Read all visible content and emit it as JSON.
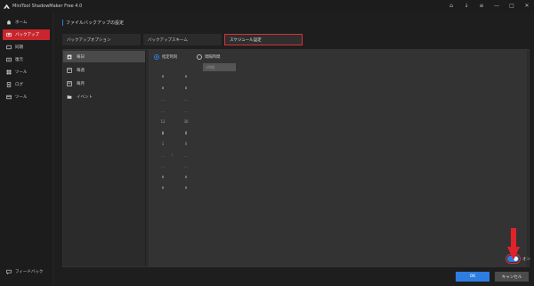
{
  "app": {
    "title": "MiniTool ShadowMaker Free 4.0",
    "window_controls": [
      "⌂",
      "↓",
      "≡",
      "—",
      "□",
      "✕"
    ]
  },
  "sidebar": {
    "items": [
      {
        "label": "ホーム",
        "icon": "home-icon",
        "active": false
      },
      {
        "label": "バックアップ",
        "icon": "backup-icon",
        "active": true
      },
      {
        "label": "同期",
        "icon": "sync-icon",
        "active": false
      },
      {
        "label": "復元",
        "icon": "restore-icon",
        "active": false
      },
      {
        "label": "ツール",
        "icon": "tools-icon",
        "active": false
      },
      {
        "label": "ログ",
        "icon": "log-icon",
        "active": false
      },
      {
        "label": "ツール",
        "icon": "tool2-icon",
        "active": false
      }
    ],
    "feedback_label": "フィードバック"
  },
  "page": {
    "title": "ファイルバックアップの設定",
    "tabs": [
      {
        "label": "バックアップオプション",
        "active": false
      },
      {
        "label": "バックアップスキーム",
        "active": false
      },
      {
        "label": "スケジュール設定",
        "active": true
      }
    ]
  },
  "schedule_types": [
    {
      "label": "毎日",
      "icon": "daily-icon",
      "active": true
    },
    {
      "label": "毎週",
      "icon": "weekly-icon",
      "active": false
    },
    {
      "label": "毎月",
      "icon": "monthly-icon",
      "active": false
    },
    {
      "label": "イベント",
      "icon": "event-icon",
      "active": false
    }
  ],
  "schedule": {
    "mode_fixed": "指定時刻",
    "mode_interval": "間隔時間",
    "interval_placeholder": "1時間",
    "colon": ":",
    "hour_column": [
      "∧",
      "∧",
      "...",
      "...",
      "12",
      "8",
      "1",
      "...",
      "...",
      "∨",
      "∨"
    ],
    "minute_column": [
      "∧",
      "∧",
      "...",
      "...",
      "30",
      "0",
      "0",
      "...",
      "...",
      "∨",
      "∨"
    ]
  },
  "footer": {
    "toggle_label": "オン",
    "toggle_on": true,
    "ok_label": "OK",
    "cancel_label": "キャンセル"
  },
  "colors": {
    "accent_blue": "#2d7de0",
    "highlight_red": "#d6313a",
    "active_nav": "#c8262c"
  }
}
